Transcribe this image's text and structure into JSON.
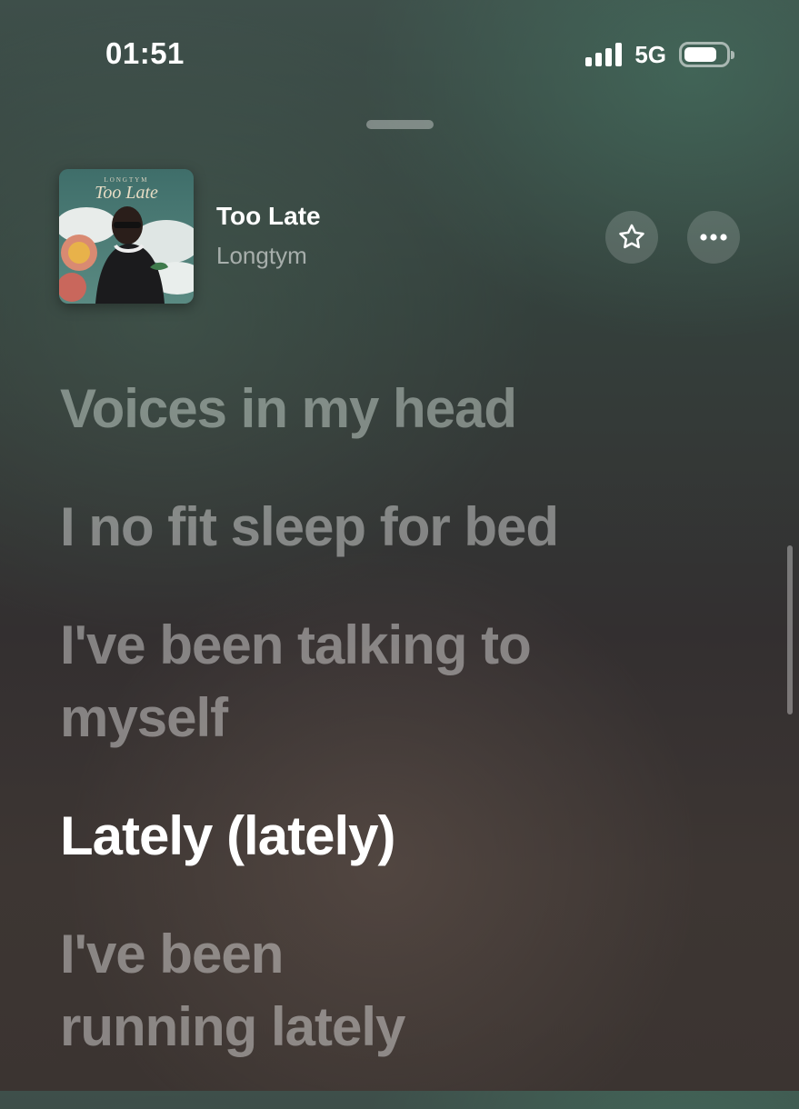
{
  "status_bar": {
    "time": "01:51",
    "network": "5G",
    "signal_bars": 4,
    "battery_level": 0.8,
    "icons": [
      "signal-icon",
      "battery-icon"
    ]
  },
  "now_playing": {
    "title": "Too Late",
    "artist": "Longtym",
    "artwork": {
      "artist_text": "LONGTYM",
      "title_text": "Too Late"
    },
    "favorite_icon": "star-icon",
    "more_icon": "ellipsis-icon"
  },
  "lyrics": {
    "lines": [
      {
        "text": "Voices in my head",
        "active": false
      },
      {
        "text": "I no fit sleep for bed",
        "active": false
      },
      {
        "text": "I've been talking to myself",
        "active": false
      },
      {
        "text": "Lately (lately)",
        "active": true
      },
      {
        "text": "I've been running lately",
        "active": false
      }
    ]
  }
}
